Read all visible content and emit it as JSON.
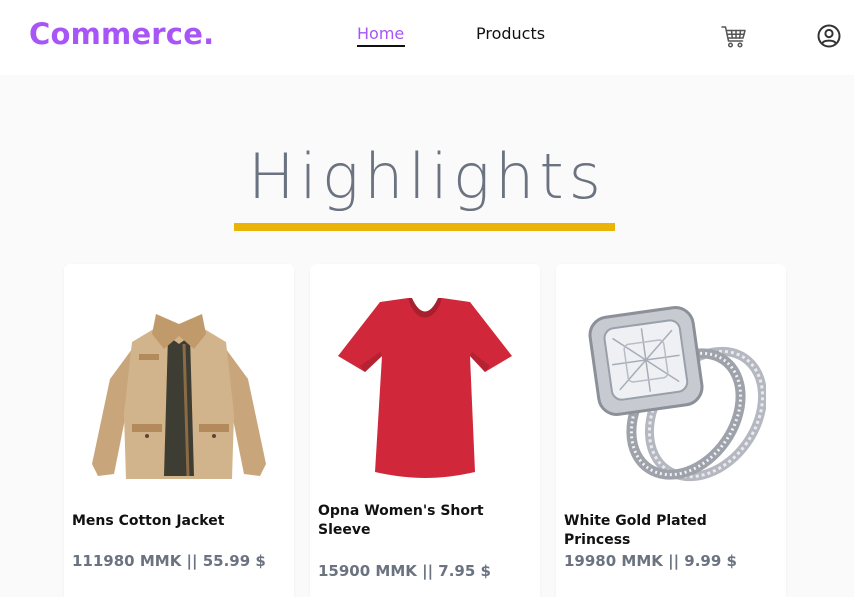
{
  "header": {
    "logo": "Commerce.",
    "nav": [
      {
        "label": "Home",
        "active": true
      },
      {
        "label": "Products",
        "active": false
      }
    ],
    "icons": [
      "cart-icon",
      "user-circle-icon"
    ]
  },
  "highlights": {
    "title": "Highlights",
    "accent_color": "#eab308"
  },
  "products": [
    {
      "name": "Mens Cotton Jacket",
      "price": "111980 MMK || 55.99 $",
      "image_icon": "jacket-image"
    },
    {
      "name": "Opna Women's Short Sleeve",
      "price": "15900 MMK || 7.95 $",
      "image_icon": "tshirt-image"
    },
    {
      "name": "White Gold Plated Princess",
      "price": "19980 MMK || 9.99 $",
      "image_icon": "ring-image"
    }
  ],
  "colors": {
    "brand": "#a855f7",
    "muted_text": "#6b7280",
    "background": "#fafafa"
  }
}
